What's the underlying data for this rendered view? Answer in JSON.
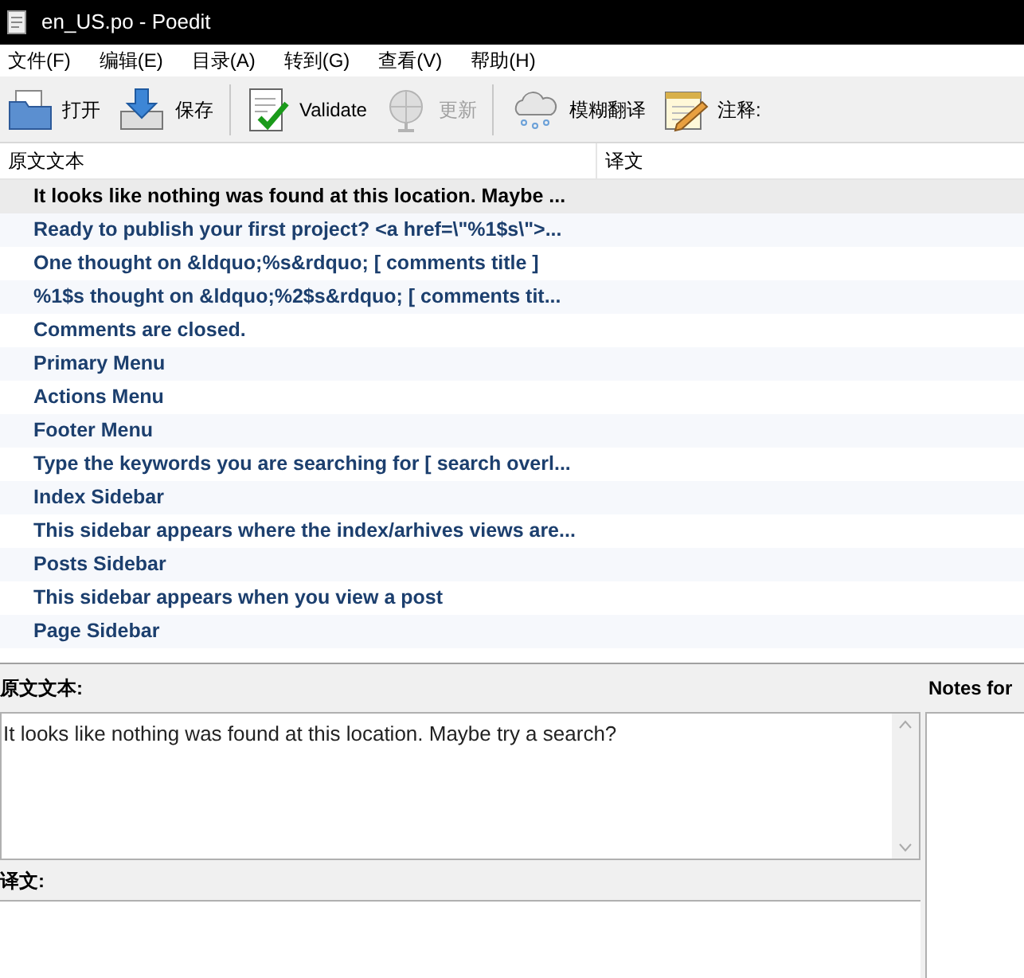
{
  "window": {
    "title": "en_US.po - Poedit"
  },
  "menu": [
    "文件(F)",
    "编辑(E)",
    "目录(A)",
    "转到(G)",
    "查看(V)",
    "帮助(H)"
  ],
  "toolbar": [
    {
      "kind": "open",
      "label": "打开",
      "disabled": false
    },
    {
      "kind": "save",
      "label": "保存",
      "disabled": false
    },
    {
      "kind": "separator"
    },
    {
      "kind": "validate",
      "label": "Validate",
      "disabled": false
    },
    {
      "kind": "update",
      "label": "更新",
      "disabled": true
    },
    {
      "kind": "separator"
    },
    {
      "kind": "fuzzy",
      "label": "模糊翻译",
      "disabled": false
    },
    {
      "kind": "comment",
      "label": "注释:",
      "disabled": false
    }
  ],
  "table": {
    "columns": [
      "原文文本",
      "译文"
    ],
    "rows": [
      {
        "source": "It looks like nothing was found at this location. Maybe ...",
        "selected": true
      },
      {
        "source": "Ready to publish your first project? <a href=\\\"%1$s\\\">...",
        "selected": false
      },
      {
        "source": "One thought on &ldquo;%s&rdquo;  [ comments title ]",
        "selected": false
      },
      {
        "source": "%1$s thought on &ldquo;%2$s&rdquo;  [ comments tit...",
        "selected": false
      },
      {
        "source": "Comments are closed.",
        "selected": false
      },
      {
        "source": "Primary Menu",
        "selected": false
      },
      {
        "source": "Actions Menu",
        "selected": false
      },
      {
        "source": "Footer Menu",
        "selected": false
      },
      {
        "source": "Type the keywords you are searching for  [ search overl...",
        "selected": false
      },
      {
        "source": "Index Sidebar",
        "selected": false
      },
      {
        "source": "This sidebar appears where the index/arhives views are...",
        "selected": false
      },
      {
        "source": "Posts Sidebar",
        "selected": false
      },
      {
        "source": "This sidebar appears when you view a post",
        "selected": false
      },
      {
        "source": "Page Sidebar",
        "selected": false
      }
    ]
  },
  "editor": {
    "source_label": "原文文本:",
    "source_text": "It looks like nothing was found at this location. Maybe try a search?",
    "translation_label": "译文:",
    "notes_label": "Notes for"
  }
}
